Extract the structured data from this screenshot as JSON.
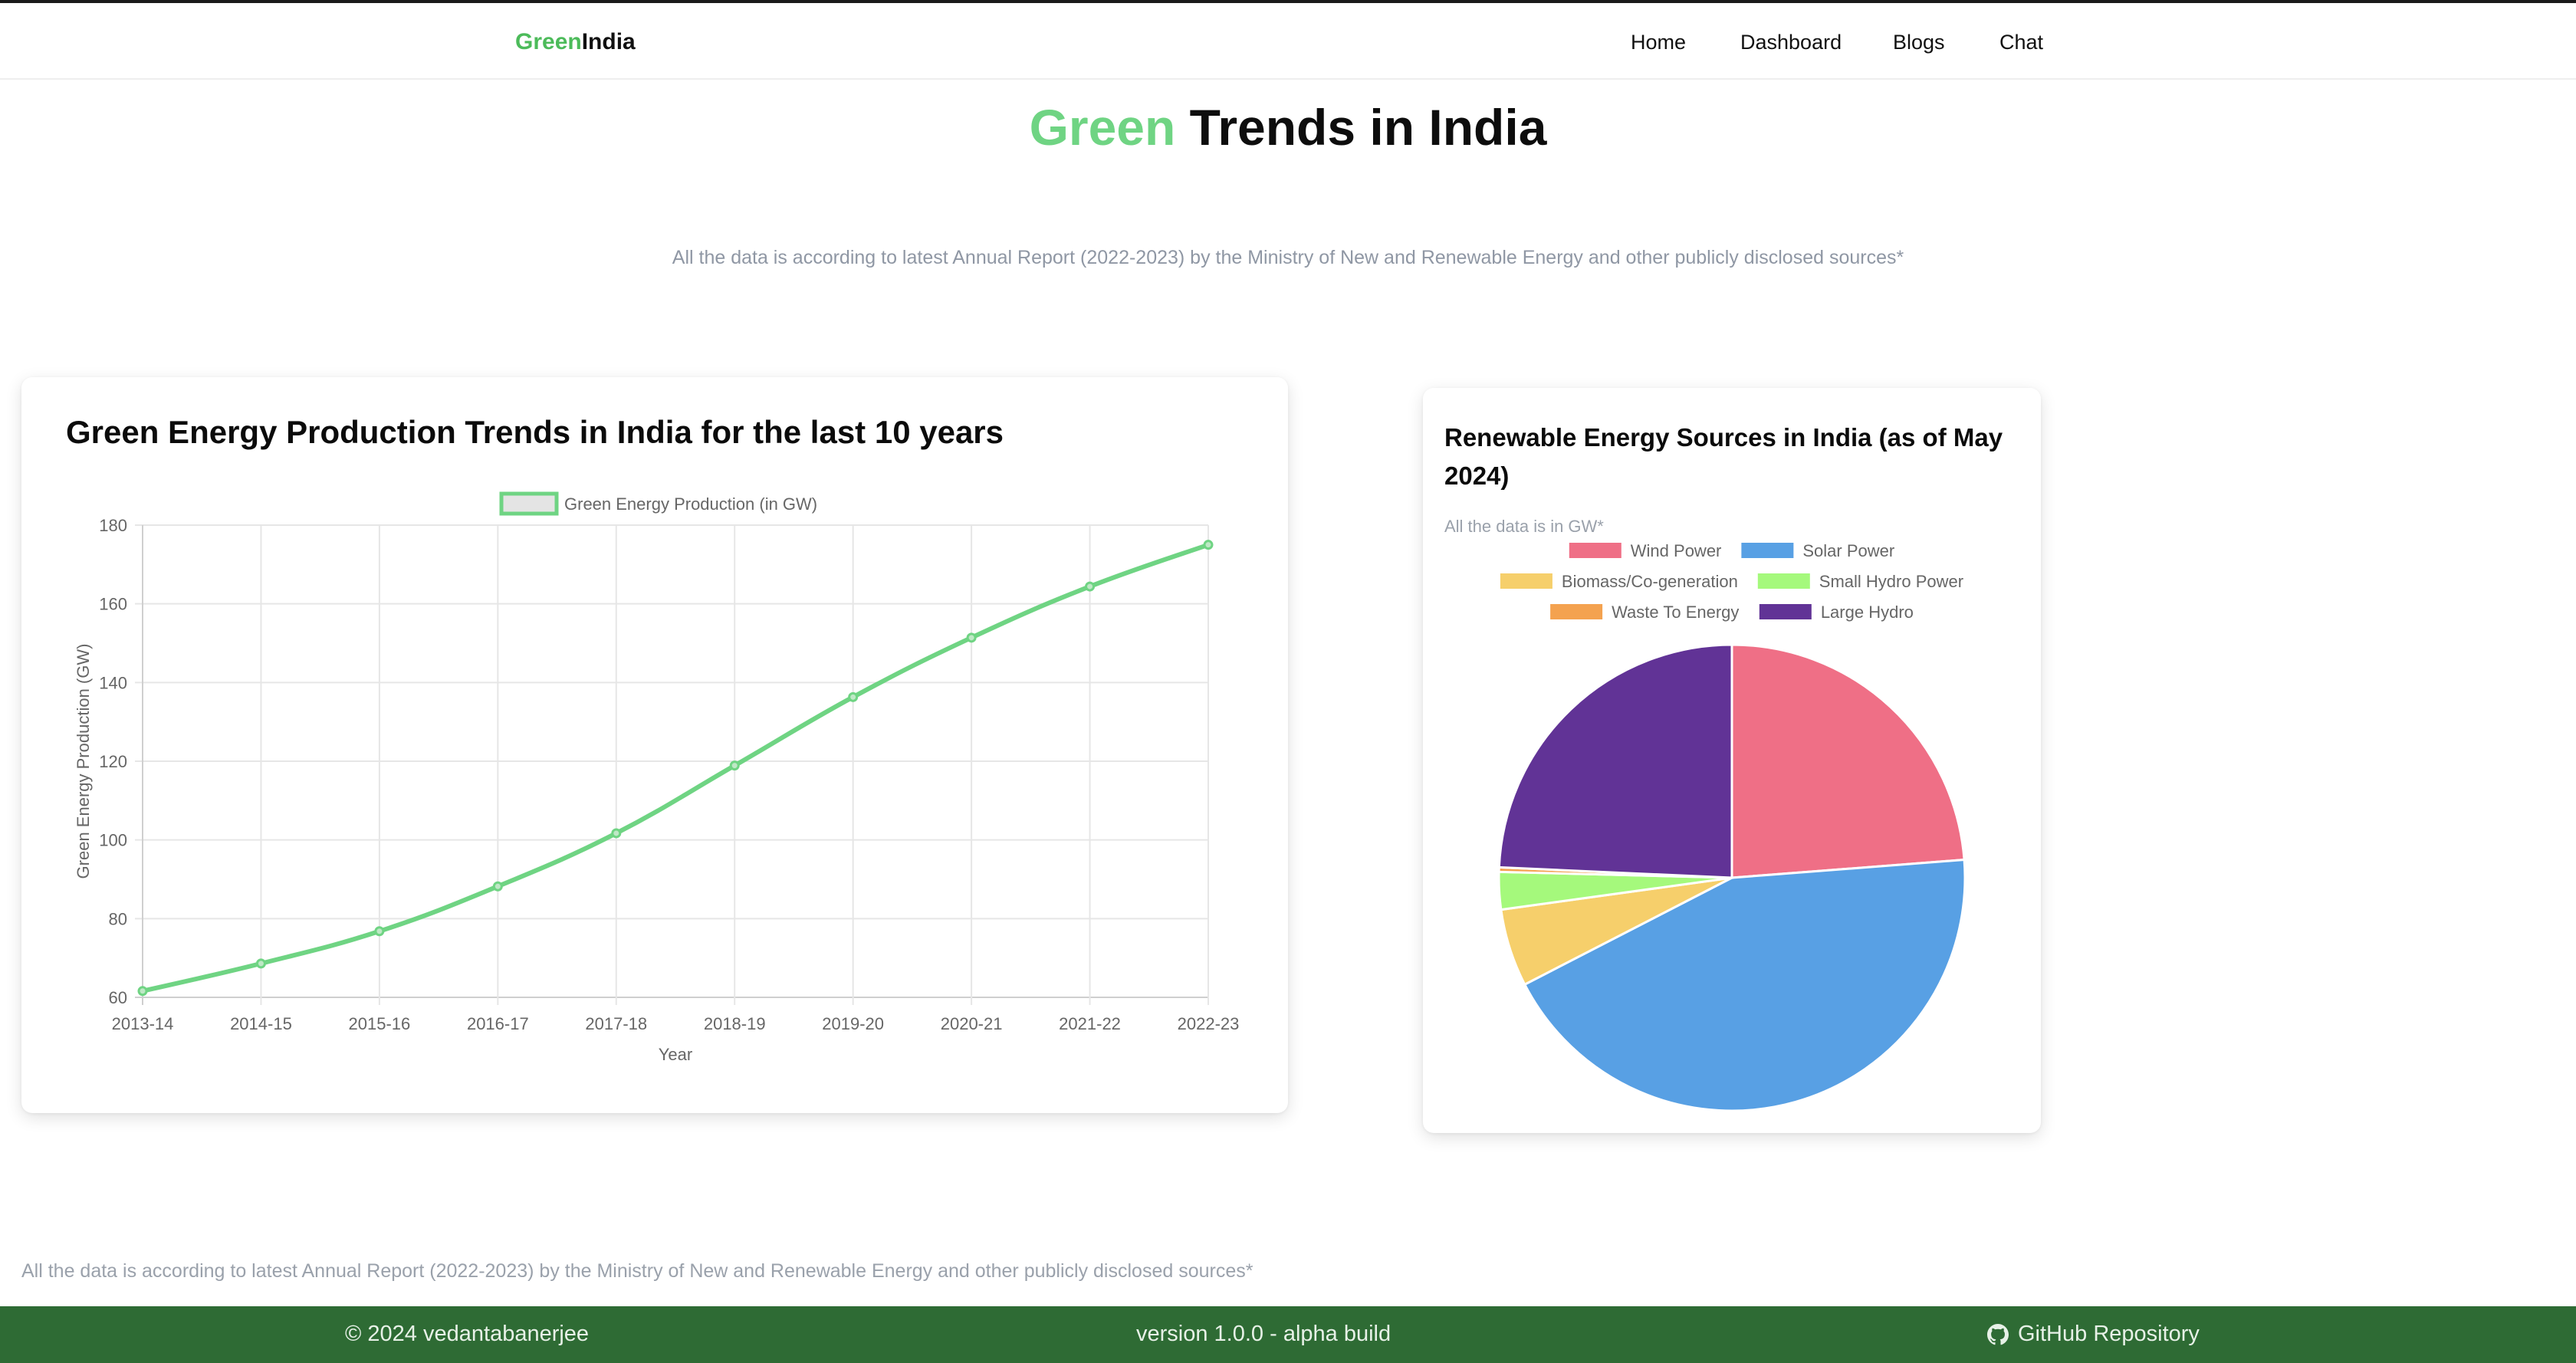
{
  "nav": {
    "brand_green": "Green",
    "brand_rest": "India",
    "links": [
      "Home",
      "Dashboard",
      "Blogs",
      "Chat"
    ]
  },
  "hero": {
    "title_green": "Green",
    "title_rest": " Trends in India",
    "subtitle": "All the data is according to latest Annual Report (2022-2023) by the Ministry of New and Renewable Energy and other publicly disclosed sources*"
  },
  "line_card": {
    "title": "Green Energy Production Trends in India for the last 10 years"
  },
  "pie_card": {
    "title": "Renewable Energy Sources in India (as of May 2024)",
    "note": "All the data is in GW*"
  },
  "chart_data": [
    {
      "type": "line",
      "title": "",
      "x": [
        "2013-14",
        "2014-15",
        "2015-16",
        "2016-17",
        "2017-18",
        "2018-19",
        "2019-20",
        "2020-21",
        "2021-22",
        "2022-23"
      ],
      "series": [
        {
          "name": "Green Energy Production (in GW)",
          "values": [
            61.6,
            68.6,
            76.8,
            88.2,
            101.7,
            118.9,
            136.3,
            151.4,
            164.4,
            175.0
          ],
          "color": "#6fd483"
        }
      ],
      "xlabel": "Year",
      "ylabel": "Green Energy Production (GW)",
      "ylim": [
        60,
        180
      ],
      "yticks": [
        60,
        80,
        100,
        120,
        140,
        160,
        180
      ],
      "grid": true,
      "legend": "top"
    },
    {
      "type": "pie",
      "title": "",
      "categories": [
        "Wind Power",
        "Solar Power",
        "Biomass/Co-generation",
        "Small Hydro Power",
        "Waste To Energy",
        "Large Hydro"
      ],
      "values": [
        45.9,
        84.3,
        10.4,
        5.0,
        0.6,
        46.9
      ],
      "colors": [
        "#ef6f86",
        "#58a0e4",
        "#f6cf6b",
        "#a5f97c",
        "#f4a24f",
        "#613396"
      ],
      "legend": "top"
    }
  ],
  "footer": {
    "note": "All the data is according to latest Annual Report (2022-2023) by the Ministry of New and Renewable Energy and other publicly disclosed sources*",
    "copyright": "© 2024 vedantabanerjee",
    "version": "version 1.0.0 - alpha build",
    "repo": "GitHub Repository",
    "repo_icon": "github-icon"
  }
}
